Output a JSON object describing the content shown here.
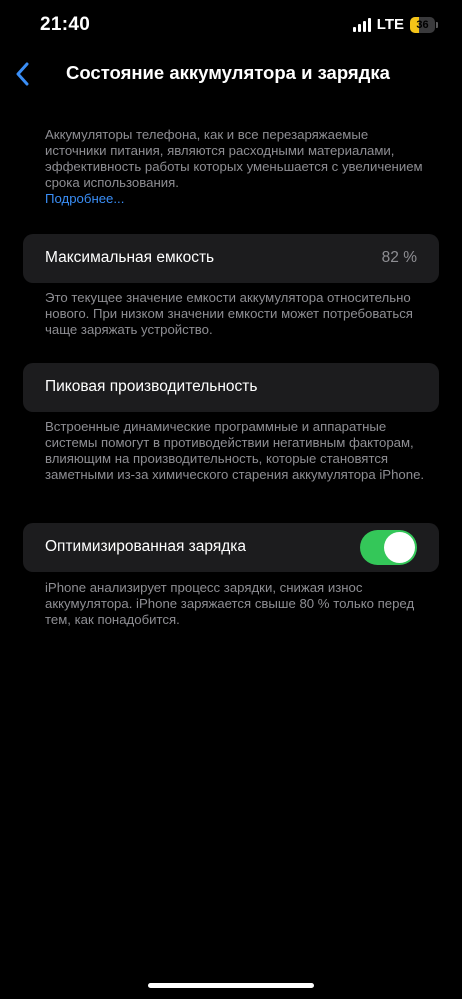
{
  "status_bar": {
    "time": "21:40",
    "network": "LTE",
    "battery_level": "36",
    "battery_color": "#f5c518"
  },
  "nav": {
    "back_icon": "chevron-left-icon",
    "title": "Состояние аккумулятора и зарядка"
  },
  "intro": {
    "text": "Аккумуляторы телефона, как и все перезаряжаемые источники питания, являются расходными материалами, эффективность работы которых уменьшается с увеличением срока использования.",
    "link": "Подробнее..."
  },
  "max_capacity": {
    "label": "Максимальная емкость",
    "value": "82 %",
    "note": "Это текущее значение емкости аккумулятора относительно нового. При низком значении емкости может потребоваться чаще заряжать устройство."
  },
  "peak_performance": {
    "label": "Пиковая производительность",
    "note": "Встроенные динамические программные и аппаратные системы помогут в противодействии негативным факторам, влияющим на производительность, которые становятся заметными из-за химического старения аккумулятора iPhone."
  },
  "optimized_charging": {
    "label": "Оптимизированная зарядка",
    "enabled": true,
    "toggle_color": "#34c759",
    "note": "iPhone анализирует процесс зарядки, снижая износ аккумулятора. iPhone заряжается свыше 80 % только перед тем, как понадобится."
  },
  "colors": {
    "background": "#000000",
    "card": "#1c1c1e",
    "secondary_text": "#8e8e93",
    "link": "#3a8ef6"
  }
}
